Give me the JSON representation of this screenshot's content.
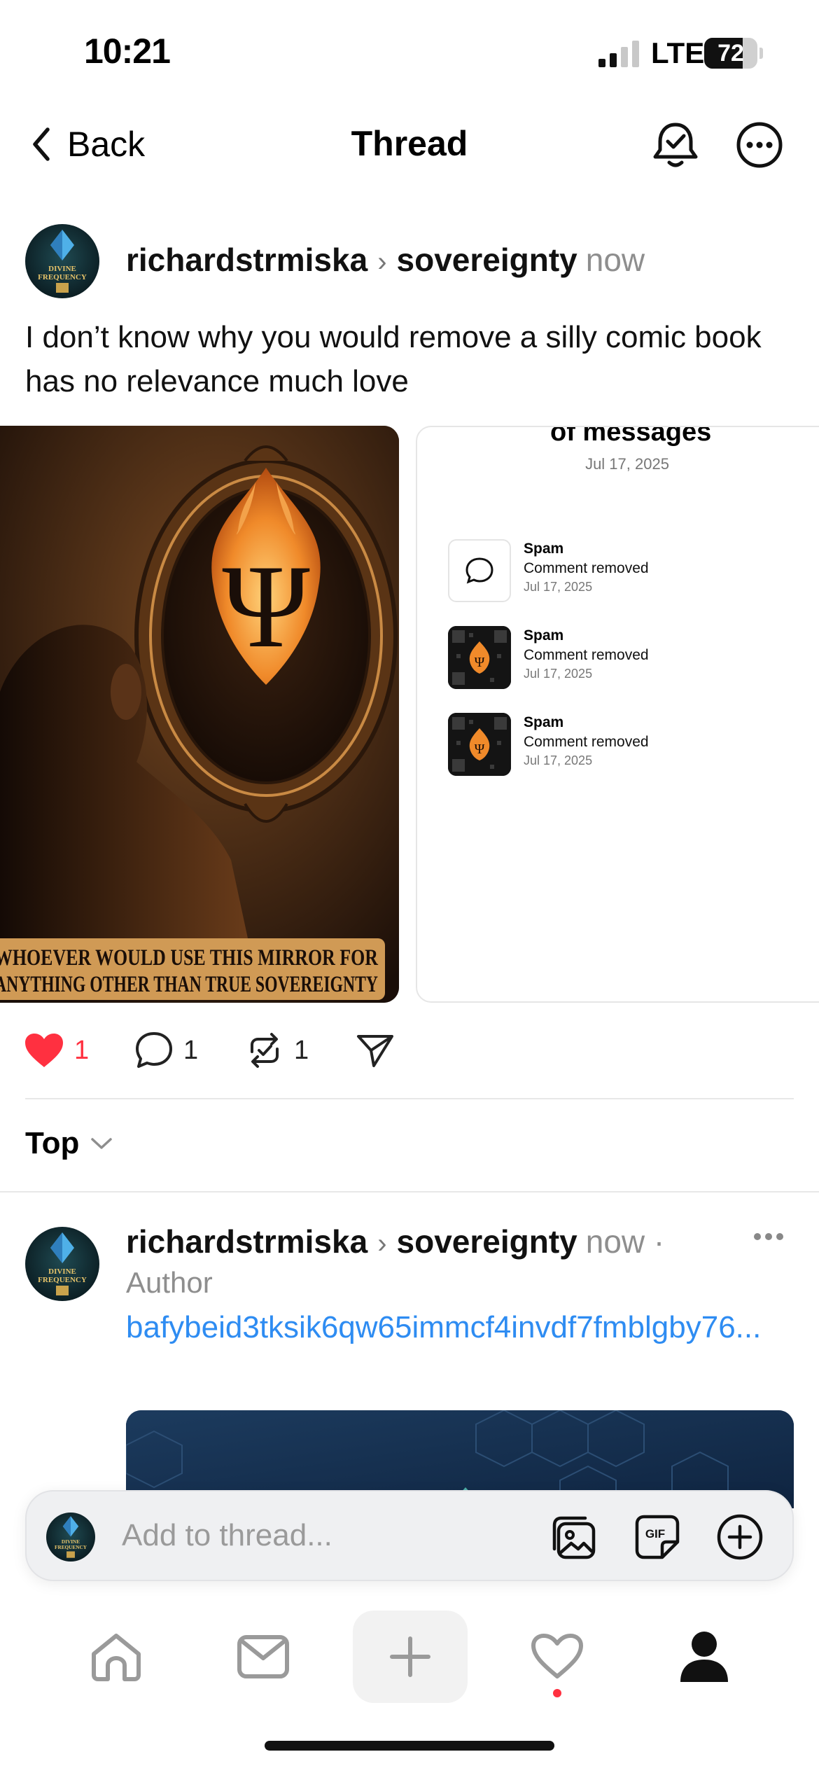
{
  "status_bar": {
    "time": "10:21",
    "network": "LTE",
    "battery": "72",
    "battery_level": 0.72,
    "icons": [
      "signal-bars-icon",
      "battery-icon"
    ]
  },
  "header": {
    "back_label": "Back",
    "title": "Thread",
    "icons": [
      "chevron-left-icon",
      "notification-bell-icon",
      "more-options-icon"
    ]
  },
  "post": {
    "avatar_text": [
      "DIVINE",
      "FREQUENCY"
    ],
    "username": "richardstrmiska",
    "community": "sovereignty",
    "time": "now",
    "text": "I don’t know why you would remove a silly comic book has no relevance much love",
    "image1_caption_line1": "WHOEVER WOULD USE THIS MIRROR FOR",
    "image1_caption_line2": "ANYTHING OTHER THAN TRUE SOVEREIGNTY",
    "image1_symbol": "Ψ",
    "image2": {
      "heading": "of messages",
      "date": "Jul 17, 2025",
      "items": [
        {
          "type": "Spam",
          "status": "Comment removed",
          "date": "Jul 17, 2025",
          "thumb": "comment-icon"
        },
        {
          "type": "Spam",
          "status": "Comment removed",
          "date": "Jul 17, 2025",
          "thumb": "flame-qr-thumbnail"
        },
        {
          "type": "Spam",
          "status": "Comment removed",
          "date": "Jul 17, 2025",
          "thumb": "flame-qr-thumbnail"
        }
      ]
    },
    "actions": {
      "likes": "1",
      "comments": "1",
      "reposts": "1",
      "liked": true,
      "like_color": "#ff3040"
    }
  },
  "sort": {
    "label": "Top"
  },
  "reply": {
    "username": "richardstrmiska",
    "community": "sovereignty",
    "time": "now ·",
    "author_tag": "Author",
    "link_text": "bafybeid3tksik6qw65immcf4invdf7fmblgby76...",
    "link_color": "#2e8cf2"
  },
  "composer": {
    "placeholder": "Add to thread...",
    "icons": [
      "photo-gallery-icon",
      "gif-icon",
      "add-circle-icon"
    ]
  },
  "tab_bar": {
    "items": [
      "home",
      "inbox",
      "create",
      "activity",
      "profile"
    ],
    "icons": [
      "home-icon",
      "inbox-icon",
      "plus-icon",
      "heart-icon",
      "profile-icon"
    ],
    "activity_dot_color": "#ff3040"
  }
}
